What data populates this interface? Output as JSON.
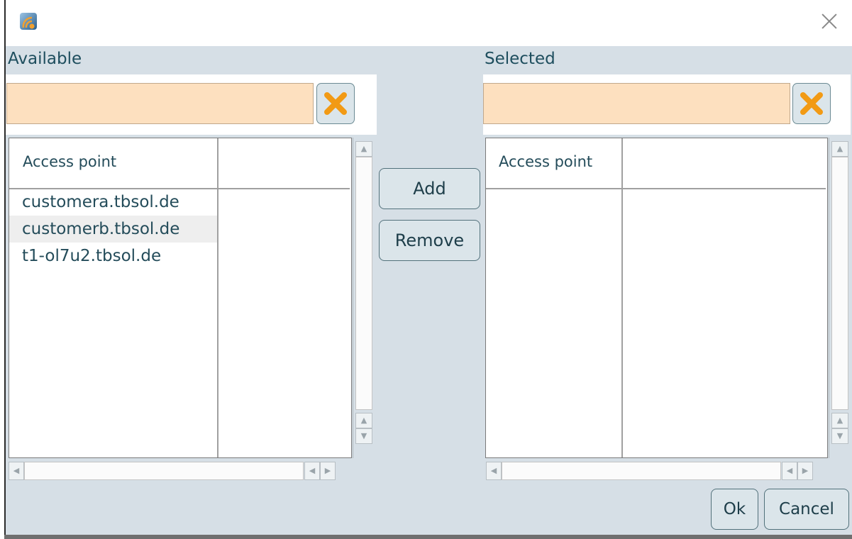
{
  "window": {
    "icon": "app-logo-icon",
    "close_icon": "close-icon"
  },
  "available": {
    "label": "Available",
    "filter": {
      "value": "",
      "placeholder": ""
    },
    "clear_icon": "clear-x-icon",
    "columns": [
      "Access point",
      ""
    ],
    "rows": [
      "customera.tbsol.de",
      "customerb.tbsol.de",
      "t1-ol7u2.tbsol.de"
    ],
    "selected_index": 1
  },
  "selected": {
    "label": "Selected",
    "filter": {
      "value": "",
      "placeholder": ""
    },
    "clear_icon": "clear-x-icon",
    "columns": [
      "Access point",
      ""
    ],
    "rows": []
  },
  "actions": {
    "add_label": "Add",
    "remove_label": "Remove",
    "ok_label": "Ok",
    "cancel_label": "Cancel"
  },
  "colors": {
    "accent_orange": "#f29a14",
    "filter_background": "#fde0bf",
    "dialog_background": "#d6dfe6",
    "text": "#244c5a"
  }
}
